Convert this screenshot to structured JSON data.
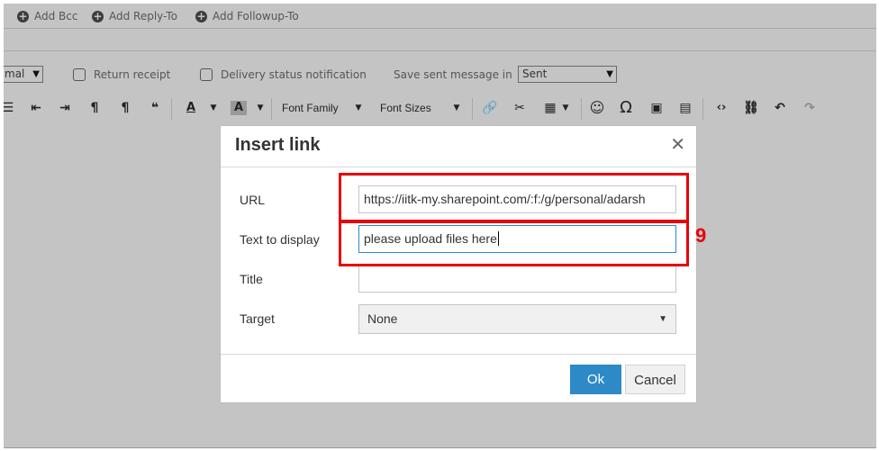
{
  "compose": {
    "links": [
      "Add Bcc",
      "Add Reply-To",
      "Add Followup-To"
    ],
    "priority_select": "mal",
    "return_receipt_label": "Return receipt",
    "delivery_status_label": "Delivery status notification",
    "save_sent_label": "Save sent message in",
    "save_sent_value": "Sent"
  },
  "toolbar": {
    "font_family": "Font Family",
    "font_sizes": "Font Sizes",
    "icons": [
      "align-justify-icon",
      "indent-left-icon",
      "indent-right-icon",
      "ltr-paragraph-icon",
      "rtl-paragraph-icon",
      "blockquote-icon",
      "text-color-icon",
      "background-color-icon",
      "link-icon",
      "unlink-icon",
      "table-icon",
      "emoji-icon",
      "special-char-icon",
      "image-icon",
      "media-icon",
      "code-icon",
      "find-replace-icon",
      "undo-icon",
      "redo-icon"
    ]
  },
  "dialog": {
    "title": "Insert link",
    "url_label": "URL",
    "url_value": "https://iitk-my.sharepoint.com/:f:/g/personal/adarsh",
    "text_label": "Text to display",
    "text_value": "please upload files here",
    "title_label": "Title",
    "title_value": "",
    "target_label": "Target",
    "target_value": "None",
    "ok_label": "Ok",
    "cancel_label": "Cancel"
  },
  "annotation": {
    "step_number": "9",
    "color": "#e8000b"
  },
  "colors": {
    "primary_button": "#2d8ac7",
    "overlay": "#c4c4c4"
  }
}
